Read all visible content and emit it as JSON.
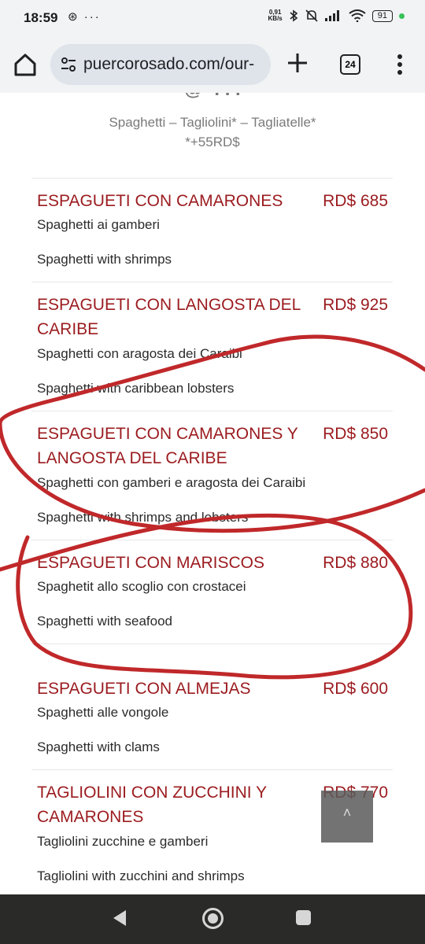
{
  "status_bar": {
    "time": "18:59",
    "left_icons": "⊛ ···",
    "speed_top": "0,91",
    "speed_bottom": "KB/s",
    "battery": "91"
  },
  "browser": {
    "url": "puercorosado.com/our-",
    "tab_count": "24"
  },
  "page": {
    "cut_heading": "@ ·. . .",
    "variants_line1": "Spaghetti – Tagliolini* – Tagliatelle*",
    "variants_line2": "*+55RD$",
    "items": [
      {
        "name": "ESPAGUETI CON CAMARONES",
        "price": "RD$ 685",
        "it": "Spaghetti ai gamberi",
        "en": "Spaghetti with shrimps"
      },
      {
        "name": "ESPAGUETI CON LANGOSTA DEL CARIBE",
        "price": "RD$ 925",
        "it": "Spaghetti con aragosta dei Caraibi",
        "en": "Spaghetti with caribbean lobsters"
      },
      {
        "name": "ESPAGUETI CON CAMARONES Y LANGOSTA DEL CARIBE",
        "price": "RD$ 850",
        "it": "Spaghetti con gamberi e aragosta dei Caraibi",
        "en": "Spaghetti with shrimps and lobsters"
      },
      {
        "name": "ESPAGUETI CON MARISCOS",
        "price": "RD$ 880",
        "it": "Spaghetit allo scoglio con crostacei",
        "en": "Spaghetti with seafood"
      },
      {
        "name": "ESPAGUETI CON ALMEJAS",
        "price": "RD$ 600",
        "it": "Spaghetti alle vongole",
        "en": "Spaghetti with clams"
      },
      {
        "name": "TAGLIOLINI CON ZUCCHINI Y CAMARONES",
        "price": "RD$ 770",
        "it": "Tagliolini zucchine e gamberi",
        "en": "Tagliolini with zucchini and shrimps"
      }
    ]
  },
  "scroll_top": {
    "icon": "chevron-up-icon",
    "glyph": "˄"
  },
  "colors": {
    "accent": "#9b1b1f",
    "annotation": "#c0282a"
  }
}
